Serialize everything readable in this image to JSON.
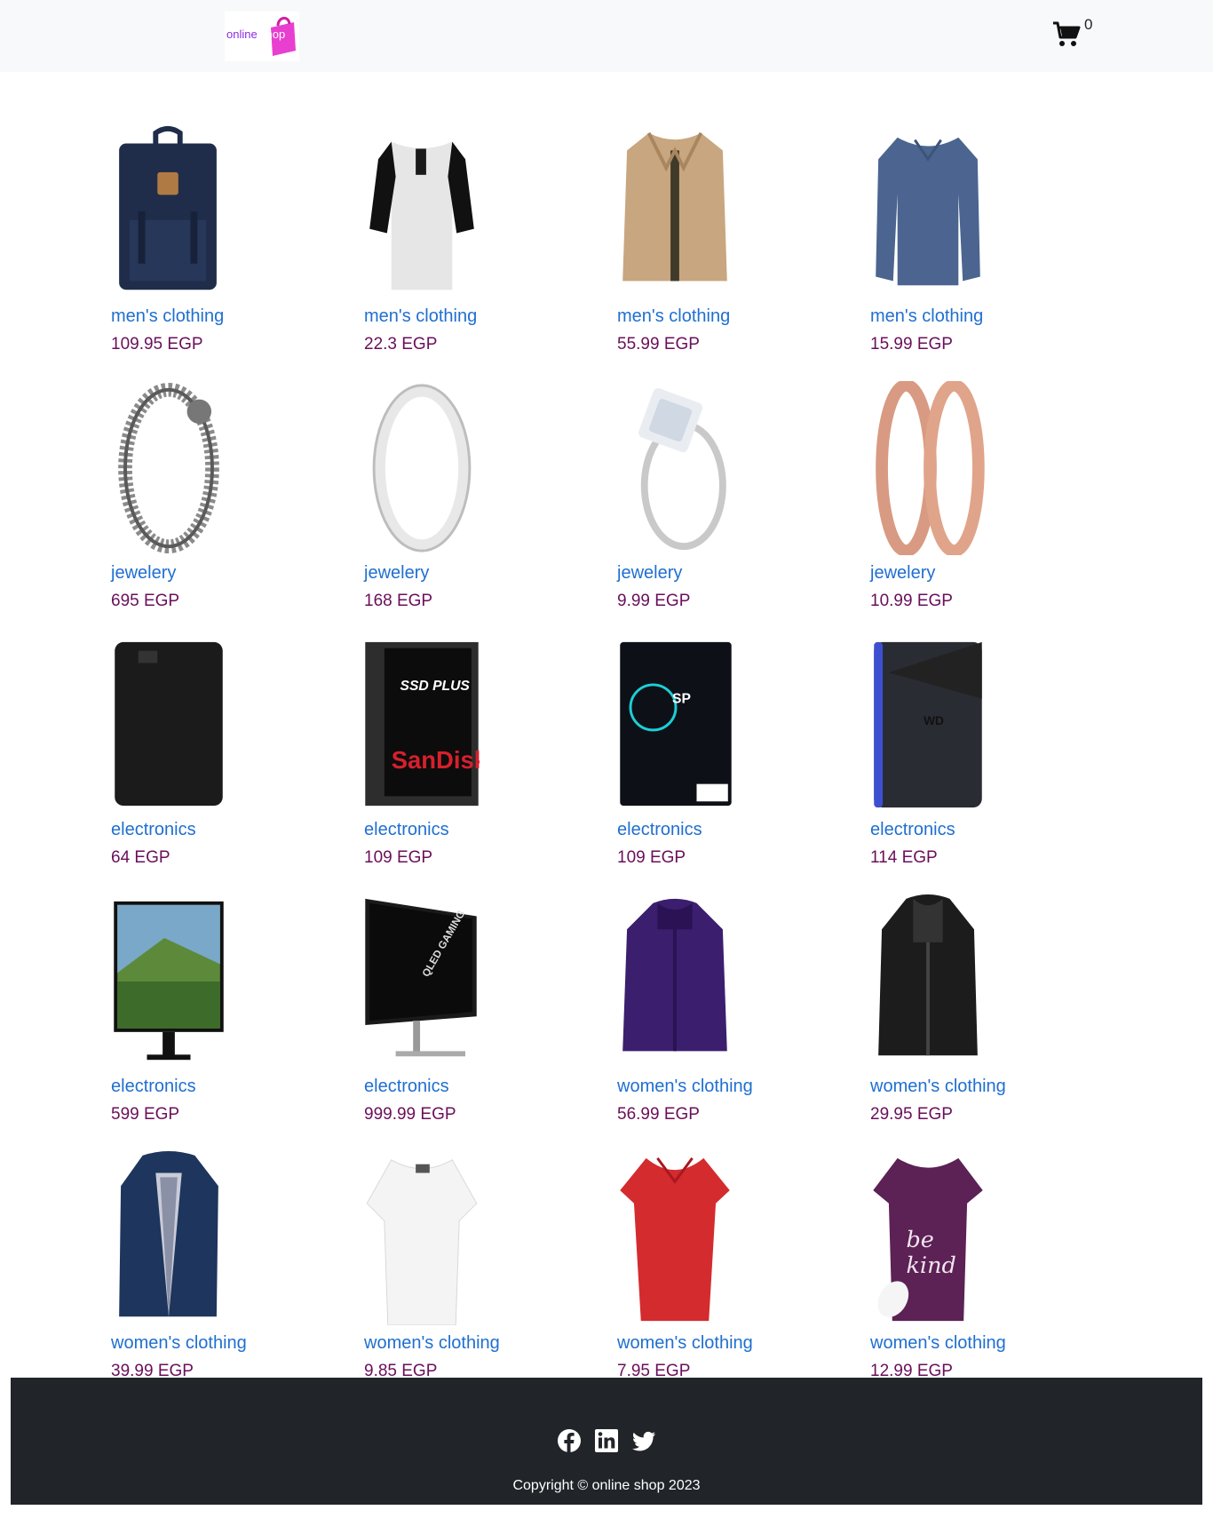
{
  "navbar": {
    "logo_text_online": "online",
    "logo_text_shop": "shop",
    "cart_icon": "shopping-cart-icon",
    "cart_count": "0"
  },
  "products": [
    {
      "category": "men's clothing",
      "price": "109.95 EGP",
      "image": "backpack"
    },
    {
      "category": "men's clothing",
      "price": "22.3 EGP",
      "image": "raglan-tshirt"
    },
    {
      "category": "men's clothing",
      "price": "55.99 EGP",
      "image": "cotton-jacket"
    },
    {
      "category": "men's clothing",
      "price": "15.99 EGP",
      "image": "slim-fit-shirt"
    },
    {
      "category": "jewelery",
      "price": "695 EGP",
      "image": "chain-bracelet"
    },
    {
      "category": "jewelery",
      "price": "168 EGP",
      "image": "silver-ring"
    },
    {
      "category": "jewelery",
      "price": "9.99 EGP",
      "image": "princess-ring"
    },
    {
      "category": "jewelery",
      "price": "10.99 EGP",
      "image": "rose-gold-earrings"
    },
    {
      "category": "electronics",
      "price": "64 EGP",
      "image": "portable-hard-drive"
    },
    {
      "category": "electronics",
      "price": "109 EGP",
      "image": "sandisk-ssd"
    },
    {
      "category": "electronics",
      "price": "109 EGP",
      "image": "silicon-power-ssd"
    },
    {
      "category": "electronics",
      "price": "114 EGP",
      "image": "wd-gaming-drive"
    },
    {
      "category": "electronics",
      "price": "599 EGP",
      "image": "monitor"
    },
    {
      "category": "electronics",
      "price": "999.99 EGP",
      "image": "curved-gaming-monitor"
    },
    {
      "category": "women's clothing",
      "price": "56.99 EGP",
      "image": "snowboard-jacket"
    },
    {
      "category": "women's clothing",
      "price": "29.95 EGP",
      "image": "leather-jacket"
    },
    {
      "category": "women's clothing",
      "price": "39.99 EGP",
      "image": "rain-jacket"
    },
    {
      "category": "women's clothing",
      "price": "9.85 EGP",
      "image": "white-top"
    },
    {
      "category": "women's clothing",
      "price": "7.95 EGP",
      "image": "red-tshirt"
    },
    {
      "category": "women's clothing",
      "price": "12.99 EGP",
      "image": "be-kind-tshirt"
    }
  ],
  "footer": {
    "social_icons": [
      "facebook-icon",
      "linkedin-icon",
      "twitter-icon"
    ],
    "copyright": "Copyright © online shop 2023"
  },
  "colors": {
    "navbar_bg": "#f8f9fa",
    "category_link": "#1f6fd0",
    "price": "#6a0f5a",
    "footer_bg": "#212529"
  }
}
